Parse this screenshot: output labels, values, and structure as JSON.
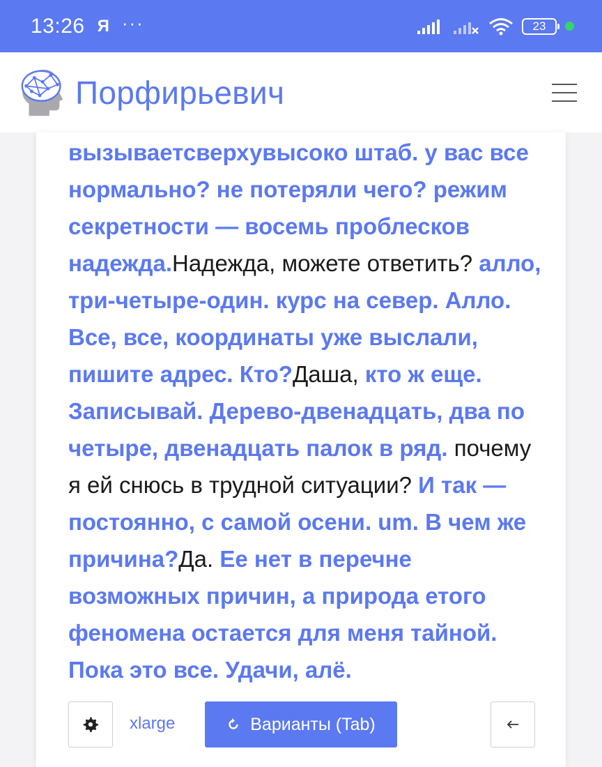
{
  "status_bar": {
    "time": "13:26",
    "app_letter": "Я",
    "dots": "···",
    "battery": "23"
  },
  "header": {
    "title": "Порфирьевич"
  },
  "story": {
    "segments": [
      {
        "type": "generated",
        "text": "вызываетсверхувысоко штаб. у вас все нормально? не потеряли чего? режим секретности — восемь проблесков надежда."
      },
      {
        "type": "user",
        "text": "Надежда, можете ответить?"
      },
      {
        "type": "generated",
        "text": " алло, три-четыре-один. курс на север. Алло. Все, все, координаты уже выслали, пишите адрес. Кто?"
      },
      {
        "type": "user",
        "text": "Даша, "
      },
      {
        "type": "generated",
        "text": "кто ж еще. Записывай. Дерево-двенадцать, два по четыре, двенадцать палок в ряд."
      },
      {
        "type": "user",
        "text": " почему я ей снюсь в трудной ситуации?"
      },
      {
        "type": "generated",
        "text": " И так — постоянно, с самой осени. um. В чем же причина?"
      },
      {
        "type": "user",
        "text": "Да. "
      },
      {
        "type": "generated",
        "text": "Ее нет в перечне возможных причин, а природа етого феномена остается для меня тайной. Пока это все. Удачи, алё."
      }
    ]
  },
  "controls": {
    "size_label": "xlarge",
    "variants_label": "Варианты (Tab)"
  },
  "colors": {
    "accent": "#5b79f0",
    "text": "#1a1a1a",
    "charge": "#35d66a"
  },
  "icons": {
    "settings": "gear-icon",
    "variants": "refresh-icon",
    "back": "arrow-left-icon",
    "menu": "hamburger-icon"
  }
}
